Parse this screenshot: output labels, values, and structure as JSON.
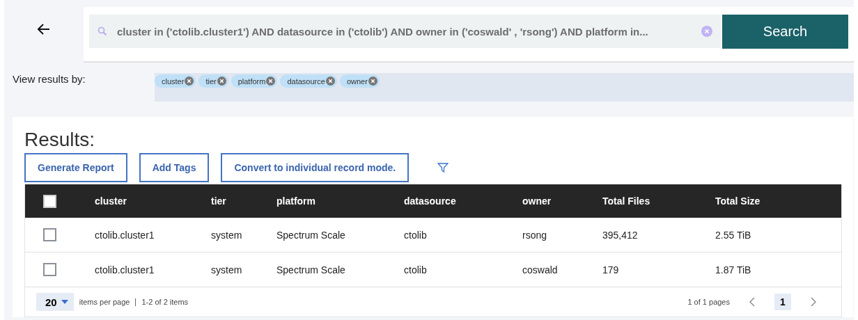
{
  "search": {
    "value": "cluster  in ('ctolib.cluster1') AND datasource  in ('ctolib') AND owner  in ('coswald' , 'rsong') AND platform  in...",
    "button": "Search"
  },
  "view_by": {
    "label": "View results by:",
    "chips": [
      "cluster",
      "tier",
      "platform",
      "datasource",
      "owner"
    ]
  },
  "results": {
    "title": "Results:",
    "actions": [
      "Generate Report",
      "Add Tags",
      "Convert to individual record mode."
    ]
  },
  "table": {
    "select_all": {
      "checked": false
    },
    "columns": [
      "cluster",
      "tier",
      "platform",
      "datasource",
      "owner",
      "Total Files",
      "Total Size"
    ],
    "rows": [
      {
        "checked": false,
        "cells": [
          "ctolib.cluster1",
          "system",
          "Spectrum Scale",
          "ctolib",
          "rsong",
          "395,412",
          "2.55 TiB"
        ]
      },
      {
        "checked": false,
        "cells": [
          "ctolib.cluster1",
          "system",
          "Spectrum Scale",
          "ctolib",
          "coswald",
          "179",
          "1.87 TiB"
        ]
      }
    ]
  },
  "pagination": {
    "page_size": "20",
    "per_page_label": "items per page",
    "range": "1-2 of 2 items",
    "pages_label": "1 of 1 pages",
    "current_page": "1"
  }
}
